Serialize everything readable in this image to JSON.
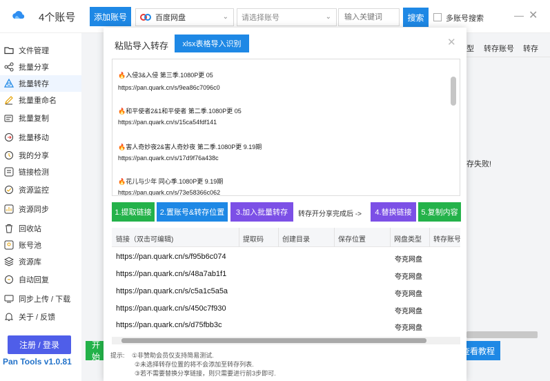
{
  "header": {
    "account_count": "4个账号",
    "add_account": "添加账号",
    "disk_select": "百度网盘",
    "account_select_placeholder": "请选择账号",
    "keyword_placeholder": "输入关键词",
    "search": "搜索",
    "multi_account_search": "多账号搜索",
    "minimize": "—",
    "close": "✕"
  },
  "sidebar": {
    "items": [
      {
        "label": "文件管理",
        "icon": "folder-icon"
      },
      {
        "label": "批量分享",
        "icon": "share-icon"
      },
      {
        "label": "批量转存",
        "icon": "transfer-icon"
      },
      {
        "label": "批量重命名",
        "icon": "rename-icon"
      },
      {
        "label": "批量复制",
        "icon": "copy-icon"
      },
      {
        "label": "批量移动",
        "icon": "move-icon"
      },
      {
        "label": "我的分享",
        "icon": "my-share-icon"
      },
      {
        "label": "链接检测",
        "icon": "link-check-icon"
      },
      {
        "label": "资源监控",
        "icon": "monitor-icon"
      },
      {
        "label": "资源同步",
        "icon": "sync-icon"
      },
      {
        "label": "回收站",
        "icon": "trash-icon"
      },
      {
        "label": "账号池",
        "icon": "account-pool-icon"
      },
      {
        "label": "资源库",
        "icon": "library-icon"
      },
      {
        "label": "自动回复",
        "icon": "auto-reply-icon"
      },
      {
        "label": "同步上传 / 下载",
        "icon": "upload-download-icon"
      },
      {
        "label": "关于 / 反馈",
        "icon": "bell-icon"
      }
    ],
    "active_index": 2,
    "register_login": "注册 / 登录",
    "version": "Pan Tools v1.0.81"
  },
  "background": {
    "col_type": "型",
    "col_transfer_account": "转存账号",
    "col_transfer": "转存",
    "fail_text": "存失败!",
    "btn_left": "开始",
    "btn_tutorial": "查看教程"
  },
  "dialog": {
    "title": "粘贴导入转存",
    "xlsx_button": "xlsx表格导入识别",
    "close": "✕",
    "paste_lines": [
      "🔥入侵3&入侵 第三季.1080P更 05",
      "https://pan.quark.cn/s/9ea86c7096c0",
      "🔥和平使者2&1和平使者 第二季.1080P更 05",
      "https://pan.quark.cn/s/15ca54fdf141",
      "🔥害人奇妙夜2&害人奇妙夜 第二季.1080P更 9.19期",
      "https://pan.quark.cn/s/17d9f76a438c",
      "🔥花儿与少年 同心季.1080P更 9.19期",
      "https://pan.quark.cn/s/73e58366c062"
    ],
    "steps": {
      "step1": "1.提取链接",
      "step2": "2.置账号&转存位置",
      "step3": "3.加入批量转存",
      "hint": "转存开分享完成后 ->",
      "step4": "4.替换链接",
      "step5": "5.复制内容"
    },
    "table": {
      "headers": [
        "链接（双击可编辑)",
        "提取码",
        "创建目录",
        "保存位置",
        "网盘类型",
        "转存账号"
      ],
      "rows": [
        {
          "link": "https://pan.quark.cn/s/f95b6c074",
          "type": "夸克网盘"
        },
        {
          "link": "https://pan.quark.cn/s/48a7ab1f1",
          "type": "夸克网盘"
        },
        {
          "link": "https://pan.quark.cn/s/c5a1c5a5a",
          "type": "夸克网盘"
        },
        {
          "link": "https://pan.quark.cn/s/450c7f930",
          "type": "夸克网盘"
        },
        {
          "link": "https://pan.quark.cn/s/d75fbb3c",
          "type": "夸克网盘"
        }
      ]
    },
    "tips": {
      "label": "提示:",
      "lines": [
        "①非赞助会员仅支持简易测试.",
        "②未选择转存位置的将不会添加至转存列表.",
        "③若不需要替换分享链接，则只需要进行前3步即可."
      ]
    }
  },
  "colors": {
    "primary_blue": "#1e88e5",
    "green": "#24b24a",
    "purple": "#7c50e6",
    "register_blue": "#4f5ee9",
    "version_blue": "#2272c9"
  }
}
